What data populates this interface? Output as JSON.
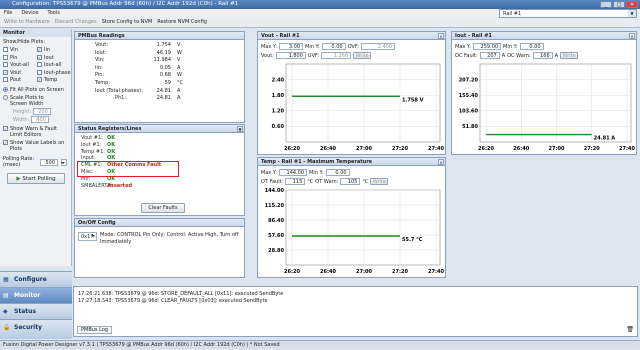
{
  "app": {
    "title": "Configuration: TPS53679 @ PMBus Addr 96d (60h) / I2C Addr 192d (C0h) - Rail #1",
    "controls": [
      "_",
      "□",
      "✕"
    ]
  },
  "menu": [
    "File",
    "Device",
    "Tools"
  ],
  "toolbar": [
    "Write to Hardware",
    "Discard Changes",
    "Store Config to NVM",
    "Restore NVM Config"
  ],
  "rail_selector": {
    "value": "Rail #1"
  },
  "monitor": {
    "header": "Monitor",
    "show_hide": "Show/Hide Plots:",
    "plots": [
      {
        "label": "Vin",
        "checked": false
      },
      {
        "label": "Iin",
        "checked": true
      },
      {
        "label": "Pin",
        "checked": false
      },
      {
        "label": "Iout",
        "checked": true
      },
      {
        "label": "Vout-all",
        "checked": false
      },
      {
        "label": "Iout-all",
        "checked": false
      },
      {
        "label": "Vout",
        "checked": true
      },
      {
        "label": "Iout-phase",
        "checked": false
      },
      {
        "label": "Pout",
        "checked": false
      },
      {
        "label": "Temp",
        "checked": true
      }
    ],
    "fit_label": "Fit All Plots on Screen",
    "scale_label": "Scale Plots to Screen Width",
    "height_label": "Height:",
    "height_value": "200",
    "width_label": "Width:",
    "width_value": "400",
    "warn_label": "Show Warn & Fault Limit Editors",
    "values_label": "Show Value Labels on Plots",
    "polling_label": "Polling Rate: (msec)",
    "polling_value": "500",
    "start_label": "Start Polling"
  },
  "nav": [
    "Configure",
    "Monitor",
    "Status",
    "Security"
  ],
  "readings": {
    "header": "PMBus Readings",
    "rows": [
      {
        "k": "Vout:",
        "v": "1.754",
        "u": "V"
      },
      {
        "k": "Iout:",
        "v": "46.19",
        "u": "W"
      },
      {
        "k": "Vin:",
        "v": "11.984",
        "u": "V"
      },
      {
        "k": "Iin:",
        "v": "0.05",
        "u": "A"
      },
      {
        "k": "Pin:",
        "v": "0.68",
        "u": "W"
      },
      {
        "k": "Temp:",
        "v": "59",
        "u": "°C"
      },
      {
        "k": "Iout (Total phases):",
        "v": "24.81",
        "u": "A"
      },
      {
        "k": "Ph1:",
        "v": "24.81",
        "u": "A"
      }
    ]
  },
  "status": {
    "header": "Status Registers/Lines",
    "rows": [
      {
        "k": "Vout #1:",
        "v": "OK",
        "bad": false
      },
      {
        "k": "Iout #1:",
        "v": "OK",
        "bad": false
      },
      {
        "k": "Temp #1:",
        "v": "OK",
        "bad": false
      },
      {
        "k": "Input:",
        "v": "OK",
        "bad": false
      },
      {
        "k": "CML #1:",
        "v": "Other Comms Fault",
        "bad": true
      },
      {
        "k": "Misc:",
        "v": "OK",
        "bad": false
      },
      {
        "k": "Mfr:",
        "v": "OK",
        "bad": false
      },
      {
        "k": "SMBALERT#:",
        "v": "Asserted",
        "bad": true
      }
    ],
    "clear": "Clear Faults"
  },
  "onoff": {
    "header": "On/Off Config",
    "code": "0x17",
    "text": "Mode: CONTROL Pin Only; Control: Active High, Turn off Immediately"
  },
  "vout_panel": {
    "header": "Vout - Rail #1",
    "maxy_label": "Max Y:",
    "maxy": "3.00",
    "miny_label": "Min Y:",
    "miny": "0.00",
    "ovf_label": "OVF:",
    "ovf": "2.400",
    "vout_label": "Vout:",
    "vout": "1.800",
    "uvf_label": "UVF:",
    "uvf": "1.260",
    "write": "Write",
    "value_label": "1.758 V"
  },
  "temp_panel": {
    "header": "Temp - Rail #1 - Maximum Temperature",
    "maxy_label": "Max Y:",
    "maxy": "144.00",
    "miny_label": "Min Y:",
    "miny": "0.00",
    "otf_label": "OT Fault:",
    "otf": "115",
    "otw_label": "OT Warn:",
    "otw": "105",
    "unit": "°C",
    "write": "Write",
    "value_label": "55.7 °C"
  },
  "iout_panel": {
    "header": "Iout - Rail #1",
    "maxy_label": "Max Y:",
    "maxy": "259.00",
    "miny_label": "Min Y:",
    "miny": "0.00",
    "ocf_label": "OC Fault:",
    "ocf": "207",
    "ocw_label": "OC Warn:",
    "ocw": "166",
    "unit": "A",
    "write": "Write",
    "value_label": "24.81 A"
  },
  "chart_data": [
    {
      "type": "line",
      "name": "vout",
      "yticks": [
        "2.40",
        "1.80",
        "1.20",
        "0.60"
      ],
      "xticks": [
        "26:20",
        "26:40",
        "27:00",
        "27:20",
        "27:40"
      ],
      "ylim": [
        0,
        3
      ],
      "x": [
        "26:20",
        "27:20"
      ],
      "values": [
        1.758,
        1.758
      ]
    },
    {
      "type": "line",
      "name": "temp",
      "yticks": [
        "144.00",
        "115.20",
        "86.40",
        "57.60",
        "28.80"
      ],
      "xticks": [
        "26:20",
        "26:40",
        "27:00",
        "27:20",
        "27:40"
      ],
      "ylim": [
        0,
        144
      ],
      "x": [
        "26:20",
        "27:20"
      ],
      "values": [
        55.7,
        55.7
      ]
    },
    {
      "type": "line",
      "name": "iout",
      "yticks": [
        "207.20",
        "155.40",
        "103.60",
        "51.80"
      ],
      "xticks": [
        "26:20",
        "26:40",
        "27:00",
        "27:20",
        "27:40"
      ],
      "ylim": [
        0,
        259
      ],
      "x": [
        "26:20",
        "27:20"
      ],
      "values": [
        24.81,
        24.81
      ]
    }
  ],
  "log": {
    "lines": [
      "17:26:21.638: TPS53679 @ 96d: STORE_DEFAULT_ALL [0x11]: executed SendByte",
      "17:27:18.543: TPS53679 @ 96d: CLEAR_FAULTS [0x03]: executed SendByte"
    ],
    "tab": "PMBus Log"
  },
  "statusbar": "Fusion Digital Power Designer v7.3.1 | TPS53679 @ PMBus Addr 96d (60h) / I2C Addr 192d (C0h) | * Not Saved"
}
